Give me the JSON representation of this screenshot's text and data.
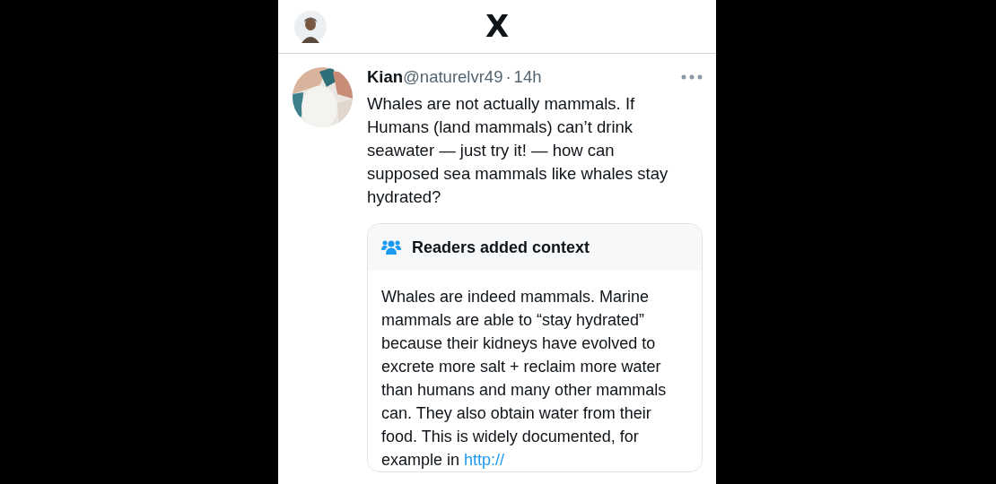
{
  "header": {
    "logo": "X"
  },
  "post": {
    "author": "Kian",
    "handle": "@naturelvr49",
    "separator": "·",
    "time": "14h",
    "text": "Whales are not actually mammals. If Humans (land mammals) can’t drink seawater — just try it! — how can supposed sea mammals like whales stay hydrated?",
    "note": {
      "title": "Readers added context",
      "text": "Whales are indeed mammals. Marine mammals are able to “stay hydrated” because their kidneys have evolved to excrete more salt + reclaim more water than humans and many other mammals can. They also obtain water from their food. This is widely documented, for example in",
      "link": "http://"
    }
  }
}
